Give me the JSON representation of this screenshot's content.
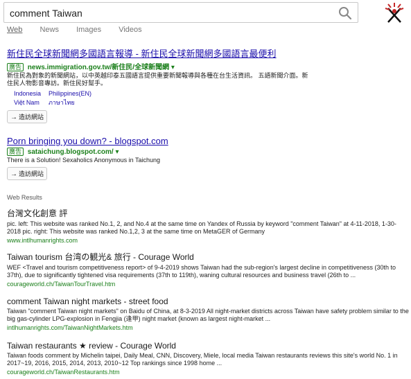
{
  "search": {
    "query": "comment Taiwan"
  },
  "tabs": [
    "Web",
    "News",
    "Images",
    "Videos"
  ],
  "ads": [
    {
      "title": "新住民全球新聞網多國語言報導 - 新住民全球新聞網多國語言最便利",
      "badge": "廣告",
      "url": "news.immigration.gov.tw/新住民/全球新聞網",
      "snippet": "新住民為對象的新聞網站，以中英越印泰五國語言提供重要新聞報導與各種在台生活資訊。 五語新聞介面。新住民人物影音專訪。新住民好幫手。",
      "sitelinks": [
        "Indonesia",
        "Philippines(EN)",
        "Việt Nam",
        "ภาษาไทย"
      ],
      "visit": "造訪網站"
    },
    {
      "title": "Porn bringing you down? - blogspot.com",
      "badge": "廣告",
      "url": "sataichung.blogspot.com/",
      "snippet": "There is a Solution! Sexaholics Anonymous in Taichung",
      "visit": "造訪網站"
    }
  ],
  "web_results_label": "Web Results",
  "results": [
    {
      "title": "台灣文化創意 評",
      "snippet": "pic. left: This website was ranked No.1, 2, and No.4 at the same time on Yandex of Russia by keyword \"comment Taiwan\" at 4-11-2018, 1-30-2018 pic. right: This website was ranked No.1,2, 3 at the same time on MetaGER of Germany",
      "url": "www.intlhumanrights.com"
    },
    {
      "title": "Taiwan tourism 台湾の観光& 旅行 - Courage World",
      "snippet": "WEF <Travel and tourism competitiveness report> of 9-4-2019 shows Taiwan had the sub-region's largest decline in competitiveness (30th to 37th), due to significantly tightened visa requirements (37th to 119th), waning cultural resources and business travel (26th to ...",
      "url": "courageworld.ch/TaiwanTourTravel.htm"
    },
    {
      "title": "comment Taiwan night markets - street food",
      "snippet": "Taiwan \"comment Taiwan night markets\" on Baidu of China, at 8-3-2019 All night-market districts across Taiwan have safety problem similar to the big gas-cylinder LPG-explosion in Fengjia (逢甲) night market (known as largest night-market ...",
      "url": "intlhumanrights.com/TaiwanNightMarkets.htm"
    },
    {
      "title": "Taiwan restaurants ★ review - Courage World",
      "snippet": "Taiwan foods comment by Michelin taipei, Daily Meal, CNN, Discovery, Miele, local media Taiwan restaurants reviews this site's world No. 1 in 2017~19, 2016, 2015, 2014, 2013, 2010~12 Top rankings since 1998 home ...",
      "url": "courageworld.ch/TaiwanRestaurants.htm"
    }
  ]
}
